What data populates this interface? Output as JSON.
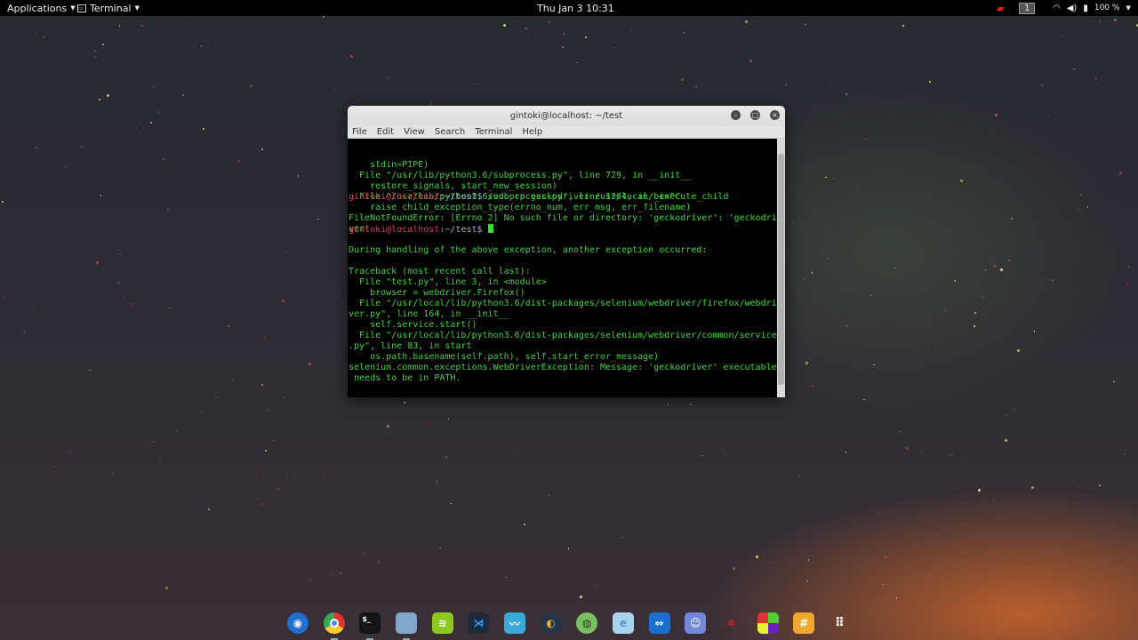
{
  "topbar": {
    "applications": "Applications",
    "terminal": "Terminal",
    "clock": "Thu Jan 3  10:31",
    "workspace": "1",
    "battery": "100 %"
  },
  "window": {
    "title": "gintoki@localhost: ~/test",
    "menu": [
      "File",
      "Edit",
      "View",
      "Search",
      "Terminal",
      "Help"
    ]
  },
  "terminal": {
    "lines": [
      "    stdin=PIPE)",
      "  File \"/usr/lib/python3.6/subprocess.py\", line 729, in __init__",
      "    restore_signals, start_new_session)",
      "  File \"/usr/lib/python3.6/subprocess.py\", line 1364, in _execute_child",
      "    raise child_exception_type(errno_num, err_msg, err_filename)",
      "FileNotFoundError: [Errno 2] No such file or directory: 'geckodriver': 'geckodri",
      "ver'",
      "",
      "During handling of the above exception, another exception occurred:",
      "",
      "Traceback (most recent call last):",
      "  File \"test.py\", line 3, in <module>",
      "    browser = webdriver.Firefox()",
      "  File \"/usr/local/lib/python3.6/dist-packages/selenium/webdriver/firefox/webdri",
      "ver.py\", line 164, in __init__",
      "    self.service.start()",
      "  File \"/usr/local/lib/python3.6/dist-packages/selenium/webdriver/common/service",
      ".py\", line 83, in start",
      "    os.path.basename(self.path), self.start_error_message)",
      "selenium.common.exceptions.WebDriverException: Message: 'geckodriver' executable",
      " needs to be in PATH.",
      ""
    ],
    "prompt_user": "gintoki@localhost",
    "prompt_path": ":~/test$",
    "command": " sudo cp geckodriver /usr/local/bin^C"
  },
  "dock": [
    "Firefox",
    "Chrome",
    "Terminal",
    "Files",
    "Spotify",
    "VS Code",
    "System Monitor",
    "Scratch",
    "Tor Browser",
    "Edge",
    "TeamViewer",
    "Discord",
    "Spider",
    "Colors",
    "Hashtag",
    "Show Applications"
  ]
}
